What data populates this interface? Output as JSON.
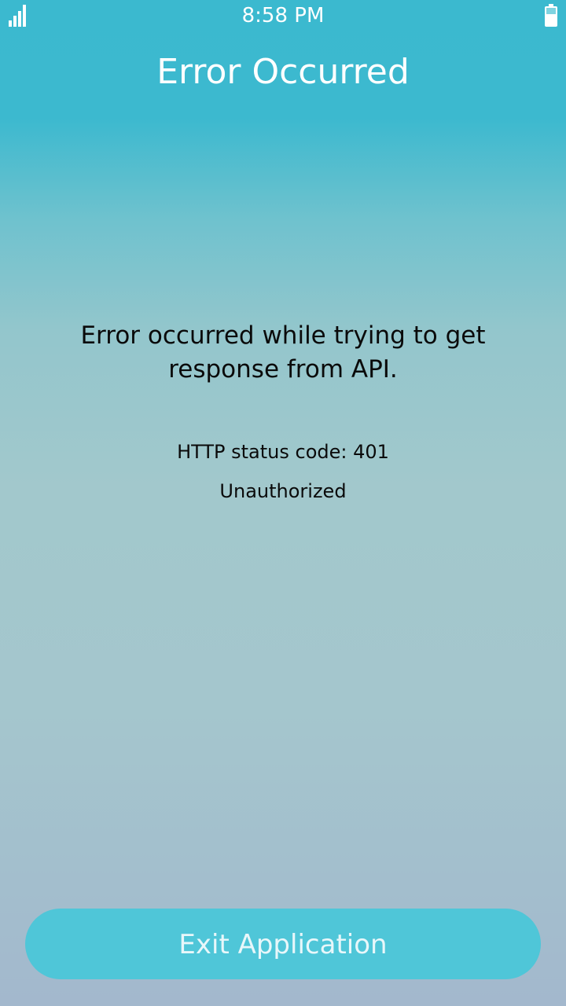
{
  "status_bar": {
    "time": "8:58 PM",
    "signal_icon": "signal-bars-icon",
    "battery_icon": "battery-icon"
  },
  "header": {
    "title": "Error Occurred"
  },
  "error": {
    "message": "Error occurred while trying to get response from API.",
    "status_code": "HTTP status code: 401",
    "status_text": "Unauthorized"
  },
  "footer": {
    "exit_label": "Exit Application"
  },
  "colors": {
    "header_top": "#3bb9cf",
    "background_bottom": "#a3b8cd",
    "button": "#4fc6d8",
    "text": "#0a0a0a"
  }
}
